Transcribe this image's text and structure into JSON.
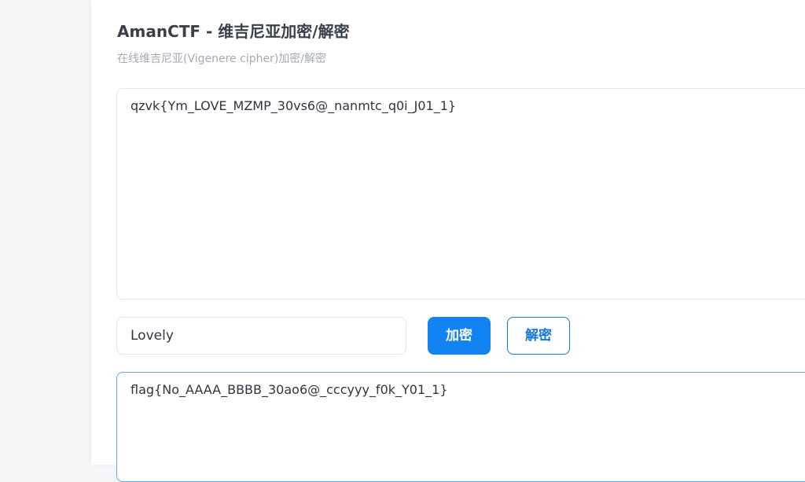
{
  "page": {
    "title": "AmanCTF - 维吉尼亚加密/解密",
    "subtitle": "在线维吉尼亚(Vigenere cipher)加密/解密"
  },
  "input": {
    "text": "qzvk{Ym_LOVE_MZMP_30vs6@_nanmtc_q0i_J01_1}"
  },
  "key": {
    "value": "Lovely"
  },
  "buttons": {
    "encrypt_label": "加密",
    "decrypt_label": "解密"
  },
  "output": {
    "text": "flag{No_AAAA_BBBB_30ao6@_cccyyy_f0k_Y01_1}"
  },
  "colors": {
    "primary": "#1183f2",
    "output_border": "#62a8e8"
  }
}
